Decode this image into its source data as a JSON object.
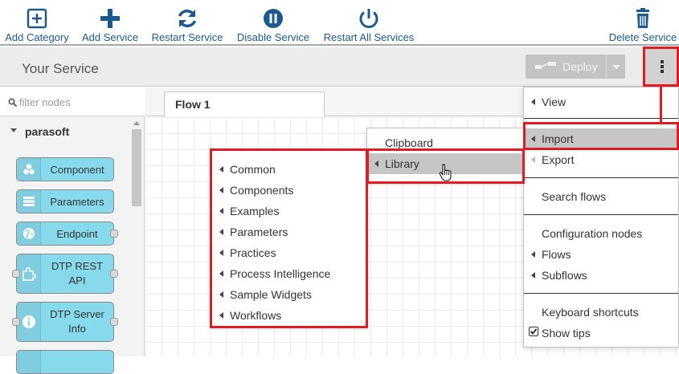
{
  "toolbar": {
    "add_category": "Add Category",
    "add_service": "Add Service",
    "restart_service": "Restart Service",
    "disable_service": "Disable Service",
    "restart_all": "Restart All Services",
    "delete_service": "Delete Service"
  },
  "header": {
    "title": "Your Service",
    "deploy_label": "Deploy"
  },
  "palette": {
    "filter_placeholder": "filter nodes",
    "category": "parasoft",
    "nodes": [
      {
        "label": "Component"
      },
      {
        "label": "Parameters"
      },
      {
        "label": "Endpoint"
      },
      {
        "label": "DTP REST API"
      },
      {
        "label": "DTP Server Info"
      }
    ]
  },
  "workspace": {
    "tab": "Flow 1"
  },
  "main_menu": {
    "items": [
      "View",
      "Import",
      "Export",
      "Search flows",
      "Configuration nodes",
      "Flows",
      "Subflows",
      "Keyboard shortcuts",
      "Show tips"
    ]
  },
  "import_menu": {
    "items": [
      "Clipboard",
      "Library"
    ]
  },
  "library_menu": {
    "items": [
      "Common",
      "Components",
      "Examples",
      "Parameters",
      "Practices",
      "Process Intelligence",
      "Sample Widgets",
      "Workflows"
    ]
  },
  "colors": {
    "toolbar_icon": "#1a5a91",
    "node_fill": "#87d9ec",
    "highlight": "#e01b22",
    "menu_selected": "#c6c6c6"
  }
}
